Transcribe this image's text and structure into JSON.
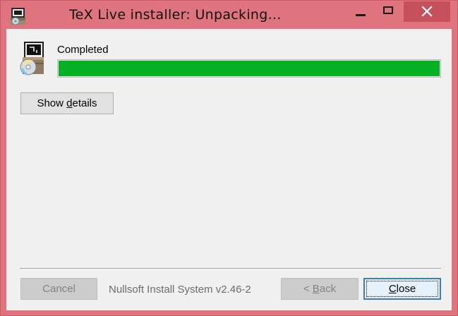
{
  "window": {
    "title": "TeX Live installer: Unpacking...",
    "icon": "installer-app-icon",
    "controls": {
      "minimize_icon": "minimize-icon",
      "maximize_icon": "maximize-icon",
      "close_icon": "close-icon"
    }
  },
  "status": {
    "icon": "setup-package-icon",
    "text": "Completed",
    "progress_percent": 100,
    "progress_color": "#06b025"
  },
  "details_button": {
    "label_pre": "Show ",
    "label_underline": "d",
    "label_post": "etails"
  },
  "footer": {
    "brand": "Nullsoft Install System v2.46-2",
    "cancel_label": "Cancel",
    "back_label_pre": "< ",
    "back_label_underline": "B",
    "back_label_post": "ack",
    "close_label_underline": "C",
    "close_label_post": "lose"
  },
  "colors": {
    "frame": "#df747e",
    "close_button": "#c7505d",
    "client_background": "#f0f0f0"
  }
}
